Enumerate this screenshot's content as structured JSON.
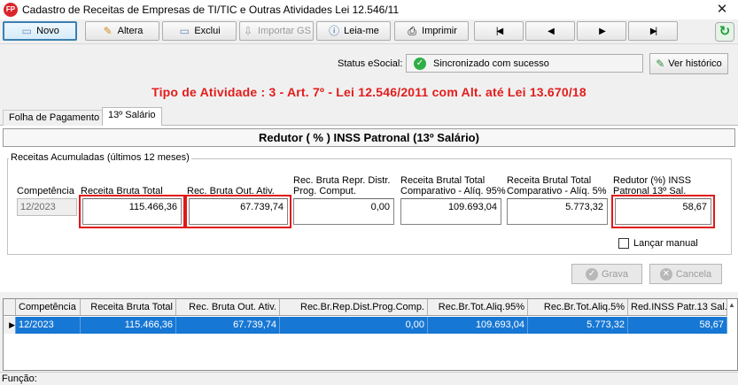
{
  "window": {
    "app_icon_text": "FP",
    "title": "Cadastro de Receitas de Empresas de TI/TIC e Outras Atividades Lei 12.546/11",
    "close_glyph": "✕"
  },
  "toolbar": {
    "novo": "Novo",
    "altera": "Altera",
    "exclui": "Exclui",
    "importar": "Importar GS",
    "leiame": "Leia-me",
    "imprimir": "Imprimir",
    "first": "|◀",
    "prev": "◀",
    "next": "▶",
    "last": "▶|"
  },
  "esocial": {
    "label": "Status eSocial:",
    "status": "Sincronizado com sucesso",
    "history_button": "Ver histórico"
  },
  "activity_title": "Tipo de Atividade : 3 - Art. 7º - Lei 12.546/2011 com Alt. até Lei 13.670/18",
  "tabs": [
    {
      "label": "Folha de Pagamento"
    },
    {
      "label": "13º Salário"
    }
  ],
  "section_title": "Redutor ( % ) INSS Patronal (13º Salário)",
  "group_title": "Receitas Acumuladas (últimos 12 meses)",
  "form": {
    "competencia_label": "Competência",
    "competencia_value": "12/2023",
    "receita_bruta_label": "Receita Bruta Total",
    "receita_bruta_value": "115.466,36",
    "rec_out_label": "Rec. Bruta Out. Ativ.",
    "rec_out_value": "67.739,74",
    "rec_repr_label_1": "Rec. Bruta Repr. Distr.",
    "rec_repr_label_2": "Prog. Comput.",
    "rec_repr_value": "0,00",
    "comp95_label_1": "Receita Brutal Total",
    "comp95_label_2": "Comparativo - Alíq. 95%",
    "comp95_value": "109.693,04",
    "comp5_label_1": "Receita Brutal Total",
    "comp5_label_2": "Comparativo - Alíq. 5%",
    "comp5_value": "5.773,32",
    "redutor_label_1": "Redutor (%) INSS",
    "redutor_label_2": "Patronal 13º Sal.",
    "redutor_value": "58,67",
    "lancar_manual_label": "Lançar manual"
  },
  "actions": {
    "grava": "Grava",
    "cancela": "Cancela"
  },
  "grid": {
    "headers": [
      "Competência",
      "Receita Bruta Total",
      "Rec. Bruta Out. Ativ.",
      "Rec.Br.Rep.Dist.Prog.Comp.",
      "Rec.Br.Tot.Aliq.95%",
      "Rec.Br.Tot.Aliq.5%",
      "Red.INSS Patr.13 Sal."
    ],
    "rows": [
      [
        "12/2023",
        "115.466,36",
        "67.739,74",
        "0,00",
        "109.693,04",
        "5.773,32",
        "58,67"
      ]
    ]
  },
  "status_bar": {
    "funcao_label": "Função:"
  },
  "colors": {
    "accent_red": "#e31c1c",
    "selection_blue": "#1777d4",
    "success_green": "#2fae46"
  }
}
